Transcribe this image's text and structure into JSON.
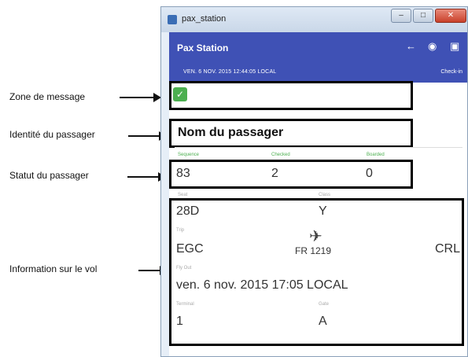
{
  "annotations": [
    {
      "label": "Zone de message"
    },
    {
      "label": "Identité du passager"
    },
    {
      "label": "Statut du passager"
    },
    {
      "label": "Information sur le vol"
    }
  ],
  "window": {
    "title": "pax_station"
  },
  "app": {
    "name": "Pax Station",
    "datetime": "VEN. 6 NOV. 2015 12:44:05 LOCAL",
    "checkin_label": "Check-in",
    "icons": [
      "arrow-left-icon",
      "user-circle-icon",
      "lock-icon"
    ]
  },
  "passenger": {
    "name": "Nom du passager"
  },
  "status": {
    "labels": {
      "sequence": "Sequence",
      "checked": "Checked",
      "boarded": "Boarded"
    },
    "values": {
      "sequence": "83",
      "checked": "2",
      "boarded": "0"
    }
  },
  "flight": {
    "seat_label": "Seat",
    "class_label": "Class",
    "seat": "28D",
    "class": "Y",
    "trip_label": "Trip",
    "origin": "EGC",
    "flight_no": "FR 1219",
    "destination": "CRL",
    "flyout_label": "Fly Out",
    "departure": "ven. 6 nov. 2015 17:05 LOCAL",
    "terminal_label": "Terminal",
    "gate_label": "Gate",
    "terminal": "1",
    "gate": "A"
  },
  "colors": {
    "appbar": "#3f51b5",
    "status_green": "#4caf50"
  }
}
